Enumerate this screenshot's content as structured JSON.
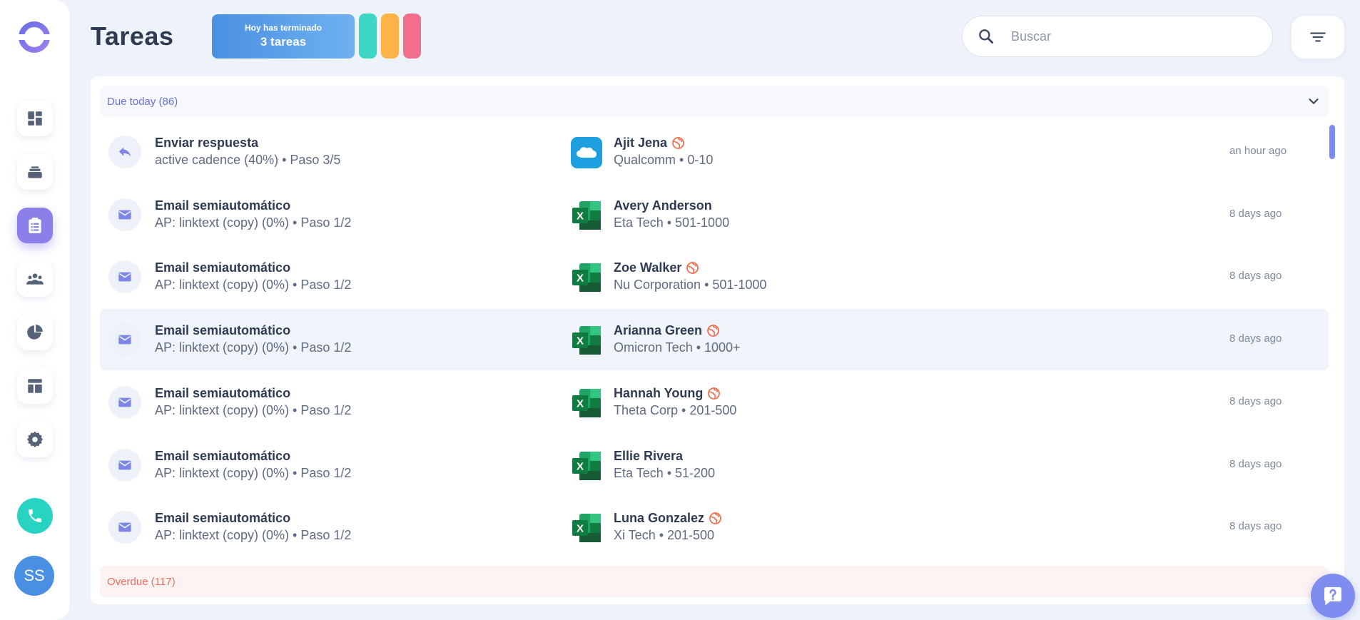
{
  "colors": {
    "accent": "#8b80ea",
    "due": "#6a6fdd",
    "overdue": "#f06b5f",
    "phone": "#29d3c2",
    "avatar": "#4a90e2",
    "pills": [
      "#3ed6c5",
      "#fdb347",
      "#f36d8c"
    ]
  },
  "sidebar": {
    "logo": "bloobirds-logo-icon",
    "items": [
      {
        "name": "dashboard",
        "icon": "dashboard-icon",
        "active": false
      },
      {
        "name": "inbox",
        "icon": "stack-icon",
        "active": false
      },
      {
        "name": "tasks",
        "icon": "clipboard-icon",
        "active": true
      },
      {
        "name": "contacts",
        "icon": "people-icon",
        "active": false
      },
      {
        "name": "reports",
        "icon": "pie-chart-icon",
        "active": false
      },
      {
        "name": "templates",
        "icon": "layout-icon",
        "active": false
      },
      {
        "name": "settings",
        "icon": "gear-icon",
        "active": false
      }
    ],
    "phone_icon": "phone-icon",
    "avatar_initials": "SS"
  },
  "header": {
    "title": "Tareas",
    "done_card": {
      "line1": "Hoy has terminado",
      "line2": "3 tareas"
    },
    "search_placeholder": "Buscar",
    "search_value": "",
    "filter_icon": "filter-icon"
  },
  "groups": {
    "due_today": {
      "label": "Due today (86)",
      "expanded": true
    },
    "overdue": {
      "label": "Overdue (117)"
    }
  },
  "tasks": [
    {
      "type_icon": "reply-icon",
      "title": "Enviar respuesta",
      "subtitle": "active cadence (40%) • Paso 3/5",
      "source_icon": "salesforce-icon",
      "contact": "Ajit Jena",
      "globe": true,
      "company": "Qualcomm • 0-10",
      "time": "an hour ago",
      "highlight": false
    },
    {
      "type_icon": "email-icon",
      "title": "Email semiautomático",
      "subtitle": "AP: linktext (copy) (0%) • Paso 1/2",
      "source_icon": "excel-icon",
      "contact": "Avery Anderson",
      "globe": false,
      "company": "Eta Tech • 501-1000",
      "time": "8 days ago",
      "highlight": false
    },
    {
      "type_icon": "email-icon",
      "title": "Email semiautomático",
      "subtitle": "AP: linktext (copy) (0%) • Paso 1/2",
      "source_icon": "excel-icon",
      "contact": "Zoe Walker",
      "globe": true,
      "company": "Nu Corporation • 501-1000",
      "time": "8 days ago",
      "highlight": false
    },
    {
      "type_icon": "email-icon",
      "title": "Email semiautomático",
      "subtitle": "AP: linktext (copy) (0%) • Paso 1/2",
      "source_icon": "excel-icon",
      "contact": "Arianna Green",
      "globe": true,
      "company": "Omicron Tech • 1000+",
      "time": "8 days ago",
      "highlight": true
    },
    {
      "type_icon": "email-icon",
      "title": "Email semiautomático",
      "subtitle": "AP: linktext (copy) (0%) • Paso 1/2",
      "source_icon": "excel-icon",
      "contact": "Hannah Young",
      "globe": true,
      "company": "Theta Corp • 201-500",
      "time": "8 days ago",
      "highlight": false
    },
    {
      "type_icon": "email-icon",
      "title": "Email semiautomático",
      "subtitle": "AP: linktext (copy) (0%) • Paso 1/2",
      "source_icon": "excel-icon",
      "contact": "Ellie Rivera",
      "globe": false,
      "company": "Eta Tech • 51-200",
      "time": "8 days ago",
      "highlight": false
    },
    {
      "type_icon": "email-icon",
      "title": "Email semiautomático",
      "subtitle": "AP: linktext (copy) (0%) • Paso 1/2",
      "source_icon": "excel-icon",
      "contact": "Luna Gonzalez",
      "globe": true,
      "company": "Xi Tech • 201-500",
      "time": "8 days ago",
      "highlight": false
    }
  ],
  "help_icon": "help-icon"
}
